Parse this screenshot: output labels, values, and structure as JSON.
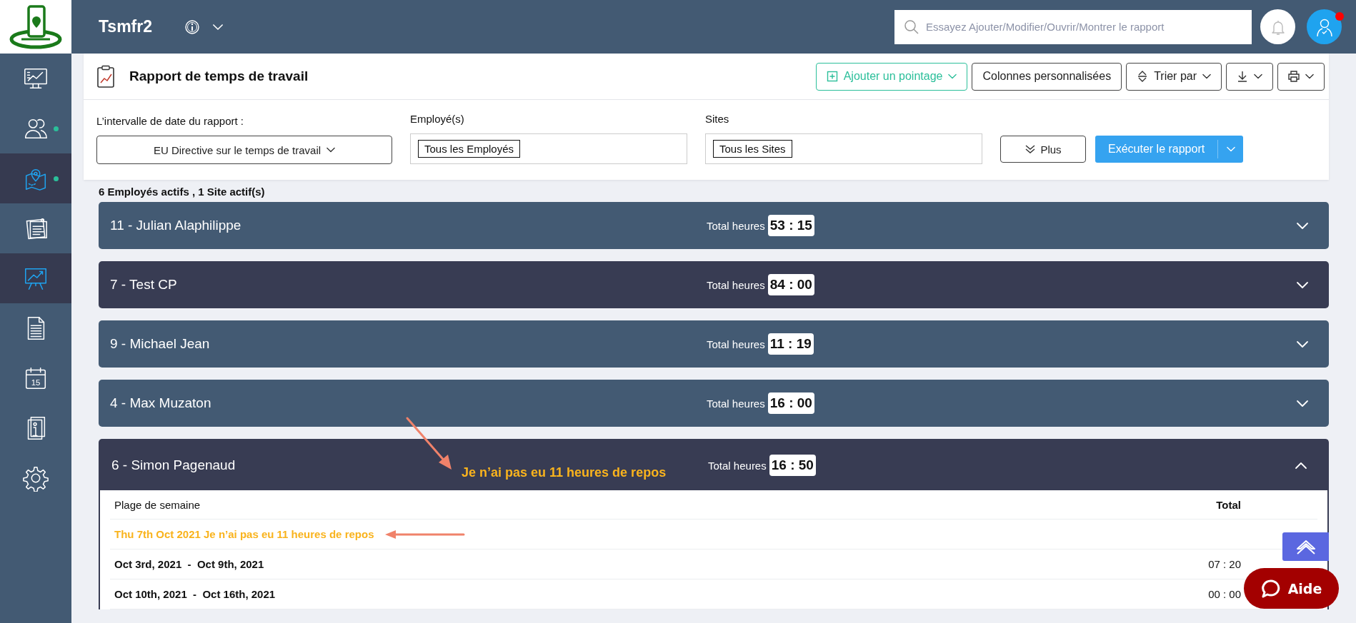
{
  "topbar": {
    "company": "Tsmfr2",
    "search": {
      "placeholder": "Essayez Ajouter/Modifier/Ouvrir/Montrer le rapport"
    },
    "avatar_alert": true
  },
  "sidebar": {
    "items": [
      {
        "selected": false,
        "dot": false
      },
      {
        "selected": false,
        "dot": true
      },
      {
        "selected": true,
        "dot": true
      },
      {
        "selected": false,
        "dot": false
      },
      {
        "selected": true,
        "dot": false
      },
      {
        "selected": false,
        "dot": false
      },
      {
        "selected": false,
        "dot": false,
        "icon_text": "15"
      },
      {
        "selected": false,
        "dot": false
      },
      {
        "selected": false,
        "dot": false
      }
    ]
  },
  "header": {
    "title": "Rapport de temps de travail",
    "buttons": [
      {
        "kind": "add",
        "label": "Ajouter un pointage"
      },
      {
        "kind": "plain",
        "label": "Colonnes personnalisées"
      },
      {
        "kind": "sort",
        "label": "Trier par"
      },
      {
        "kind": "download"
      },
      {
        "kind": "print"
      }
    ]
  },
  "filters": {
    "date_range": {
      "label": "L’intervalle de date du rapport :",
      "value": "EU Directive sur le temps de travail"
    },
    "employees": {
      "label": "Employé(s)",
      "tag": "Tous les Employés"
    },
    "sites": {
      "label": "Sites",
      "tag": "Tous les Sites"
    },
    "more_button": "Plus",
    "run_button": "Exécuter le rapport"
  },
  "summary": "6 Employés actifs , 1 Site actif(s)",
  "employees": [
    {
      "name": "11 - Julian Alaphilippe",
      "total_label": "Total heures",
      "total": "53 : 15",
      "highlighted": false,
      "expanded": false
    },
    {
      "name": "7 - Test CP",
      "total_label": "Total heures",
      "total": "84 : 00",
      "highlighted": true,
      "expanded": false
    },
    {
      "name": "9 - Michael Jean",
      "total_label": "Total heures",
      "total": "11 : 19",
      "highlighted": false,
      "expanded": false
    },
    {
      "name": "4 - Max Muzaton",
      "total_label": "Total heures",
      "total": "16 : 00",
      "highlighted": false,
      "expanded": false
    },
    {
      "name": "6 - Simon Pagenaud",
      "total_label": "Total heures",
      "total": "16 : 50",
      "highlighted": true,
      "expanded": true,
      "note": "Je n’ai pas eu 11 heures de repos",
      "table": {
        "columns": [
          "Plage de semaine",
          "Total"
        ],
        "rows": [
          {
            "kind": "warning",
            "range": "Thu 7th Oct 2021 Je n’ai pas eu 11 heures de repos"
          },
          {
            "kind": "week",
            "range": "Oct 3rd, 2021  -  Oct 9th, 2021",
            "total": "07 : 20"
          },
          {
            "kind": "week",
            "range": "Oct 10th, 2021  -  Oct 16th, 2021",
            "total": "00 : 00"
          }
        ]
      }
    }
  ],
  "help_button": "Aide"
}
